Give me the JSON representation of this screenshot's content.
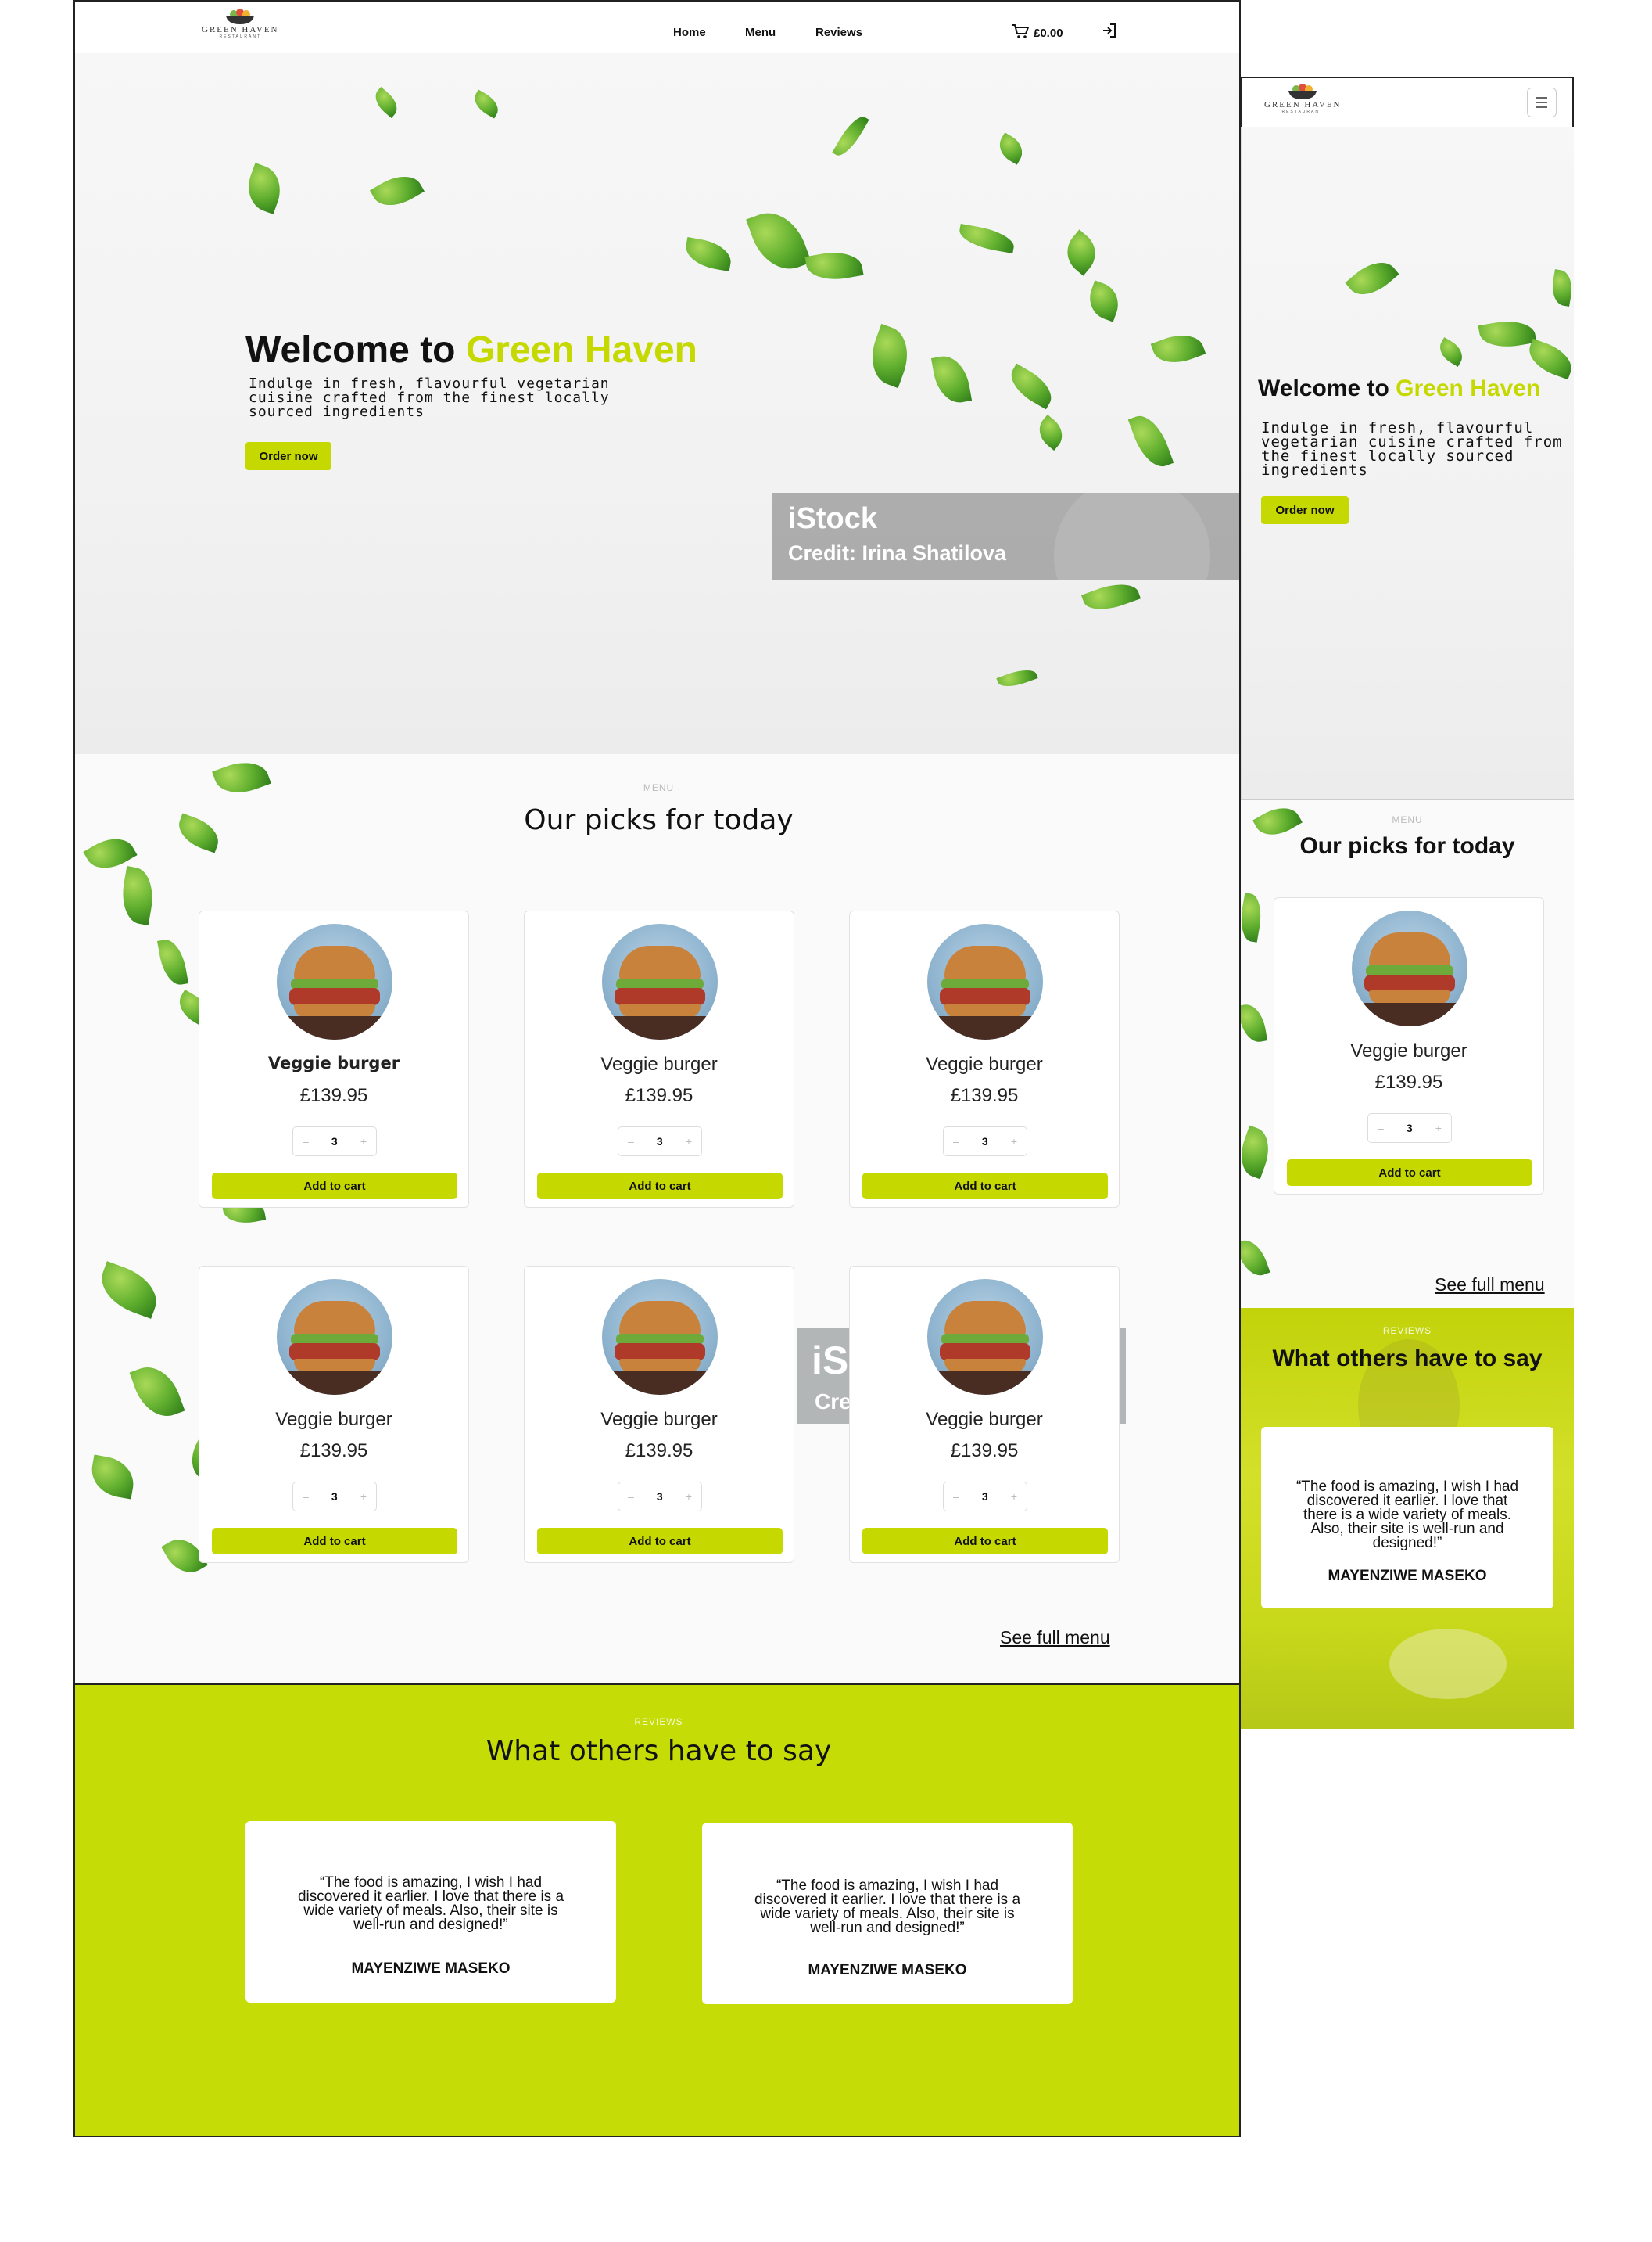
{
  "brand": {
    "name": "GREEN HAVEN",
    "tagline": "RESTAURANT"
  },
  "nav": {
    "links": [
      "Home",
      "Menu",
      "Reviews"
    ],
    "cart_total": "£0.00"
  },
  "hero": {
    "title_prefix": "Welcome to ",
    "title_brand": "Green Haven",
    "subtitle": "Indulge in fresh, flavourful vegetarian cuisine crafted from the finest locally sourced ingredients",
    "cta": "Order now",
    "watermark_logo": "iStock",
    "watermark_credit": "Credit: Irina Shatilova"
  },
  "menu": {
    "kicker": "MENU",
    "title": "Our picks for today",
    "items": [
      {
        "name": "Veggie burger",
        "price": "£139.95",
        "qty": "3",
        "button": "Add to cart"
      },
      {
        "name": "Veggie burger",
        "price": "£139.95",
        "qty": "3",
        "button": "Add to cart"
      },
      {
        "name": "Veggie burger",
        "price": "£139.95",
        "qty": "3",
        "button": "Add to cart"
      },
      {
        "name": "Veggie burger",
        "price": "£139.95",
        "qty": "3",
        "button": "Add to cart"
      },
      {
        "name": "Veggie burger",
        "price": "£139.95",
        "qty": "3",
        "button": "Add to cart"
      },
      {
        "name": "Veggie burger",
        "price": "£139.95",
        "qty": "3",
        "button": "Add to cart"
      }
    ],
    "see_full": "See full menu",
    "partial_watermark_1": "iS",
    "partial_watermark_2": "Cre"
  },
  "reviews": {
    "kicker": "REVIEWS",
    "title": "What others have to say",
    "items": [
      {
        "quote": "“The food is amazing, I wish I had discovered it earlier. I love that there is a wide variety of meals. Also, their site is well-run and designed!”",
        "author": "MAYENZIWE MASEKO"
      },
      {
        "quote": "“The food is amazing, I wish I had discovered it earlier. I love that there is a wide variety of meals. Also, their site is well-run and designed!”",
        "author": "MAYENZIWE MASEKO"
      }
    ]
  },
  "mobile": {
    "menu_item": {
      "name": "Veggie burger",
      "price": "£139.95",
      "qty": "3",
      "button": "Add to cart"
    },
    "review": {
      "quote": "“The food is amazing, I wish I had discovered it earlier. I love that there is a wide variety of meals. Also, their site is well-run and designed!”",
      "author": "MAYENZIWE MASEKO"
    }
  },
  "icons": {
    "cart": "cart-icon",
    "login": "login-icon",
    "menu": "hamburger-icon"
  },
  "colors": {
    "accent": "#c5d900",
    "reviews_bg": "#c5dc06"
  }
}
